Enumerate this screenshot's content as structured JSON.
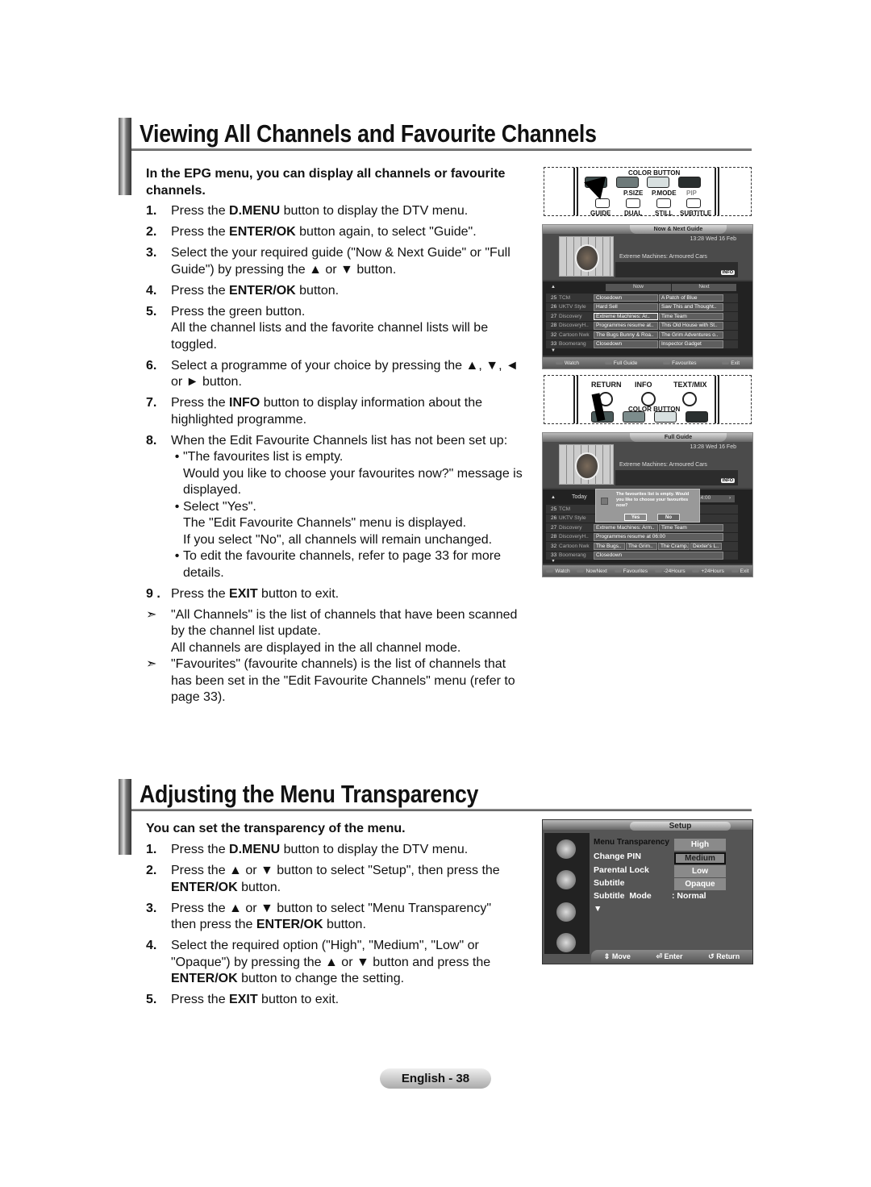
{
  "section1": {
    "title": "Viewing All Channels and Favourite Channels",
    "intro": "In the EPG menu, you can display all channels or favourite channels.",
    "steps": [
      {
        "num": "1.",
        "pre": "Press the ",
        "bold": "D.MENU",
        "post": " button to display the DTV menu."
      },
      {
        "num": "2.",
        "pre": "Press the ",
        "bold": "ENTER/OK",
        "post": " button again, to select \"Guide\"."
      },
      {
        "num": "3.",
        "pre": "Select the your required guide (\"Now & Next Guide\" or \"Full Guide\") by pressing the ▲ or ▼ button.",
        "bold": "",
        "post": ""
      },
      {
        "num": "4.",
        "pre": "Press the ",
        "bold": "ENTER/OK",
        "post": " button."
      },
      {
        "num": "5.",
        "pre": "Press the green button.",
        "bold": "",
        "post": "",
        "extra": "All the channel lists and the favorite channel lists will be toggled."
      },
      {
        "num": "6.",
        "pre": "Select a programme of your choice by pressing the ▲, ▼, ◄ or ► button.",
        "bold": "",
        "post": ""
      },
      {
        "num": "7.",
        "pre": "Press the ",
        "bold": "INFO",
        "post": " button to display information about the highlighted programme."
      },
      {
        "num": "8.",
        "pre": "When the Edit Favourite Channels list has not been set up:",
        "bold": "",
        "post": "",
        "bullets": [
          {
            "lines": [
              "\"The favourites list is empty.",
              "Would you like to choose your favourites now?\" message is displayed."
            ]
          },
          {
            "lines": [
              "Select \"Yes\".",
              "The \"Edit Favourite Channels\" menu is displayed.",
              "If you select \"No\", all channels will remain unchanged."
            ]
          },
          {
            "lines": [
              "To edit the favourite channels, refer to page 33 for more details."
            ]
          }
        ]
      },
      {
        "num": "9 .",
        "pre": "Press the ",
        "bold": "EXIT",
        "post": " button to exit."
      }
    ],
    "notes": [
      {
        "lines": [
          "\"All Channels\" is the list of channels that have been scanned by the channel list update.",
          "All channels are displayed in the all channel mode."
        ]
      },
      {
        "lines": [
          "\"Favourites\" (favourite channels) is the list of channels that has been set in the \"Edit Favourite Channels\" menu (refer to page 33)."
        ]
      }
    ],
    "note_symbol": "➣"
  },
  "remote1": {
    "color_button": "COLOR BUTTON",
    "labels": [
      "P.SIZE",
      "P.MODE",
      "PIP"
    ],
    "bottom_labels": [
      "GUIDE",
      "DUAL",
      "STILL",
      "SUBTITLE"
    ],
    "colors": [
      "#6e7a7a",
      "#d8e0e0",
      "#2a2f2f"
    ]
  },
  "remote2": {
    "labels": [
      "RETURN",
      "INFO",
      "TEXT/MIX"
    ],
    "color_button": "COLOR BUTTON",
    "colors": [
      "#4a5a5a",
      "#7c8c8c",
      "#d8e0e0",
      "#2a2f2f"
    ]
  },
  "now_next": {
    "header": "Now & Next Guide",
    "time": "13:28 Wed 16 Feb",
    "programme": "Extreme Machines: Armoured Cars",
    "info_badge": "INFO",
    "col_now": "Now",
    "col_next": "Next",
    "rows": [
      {
        "num": "25",
        "name": "TCM",
        "now": "Closedown",
        "next": "A Patch of Blue"
      },
      {
        "num": "26",
        "name": "UKTV Style",
        "now": "Hard Sell",
        "next": "Saw This and Thought.."
      },
      {
        "num": "27",
        "name": "Discovery",
        "now": "Extreme Machines: Ar..",
        "next": "Time Team"
      },
      {
        "num": "28",
        "name": "DiscoveryH..",
        "now": "Programmes resume at..",
        "next": "This Old House with St.."
      },
      {
        "num": "32",
        "name": "Cartoon Nwk",
        "now": "The Bugs Bunny & Roa..",
        "next": "The Grim Adventures o.."
      },
      {
        "num": "33",
        "name": "Boomerang",
        "now": "Closedown",
        "next": "Inspector Gadget"
      }
    ],
    "footer": [
      "Watch",
      "Full Guide",
      "Favourites",
      "Exit"
    ]
  },
  "full_guide": {
    "header": "Full Guide",
    "time": "13:28 Wed 16 Feb",
    "programme": "Extreme Machines: Armoured Cars",
    "info_badge": "INFO",
    "date": "Today",
    "time_col": "14:00",
    "rows": [
      {
        "num": "25",
        "name": "TCM",
        "cells": []
      },
      {
        "num": "26",
        "name": "UKTV Style",
        "cells": []
      },
      {
        "num": "27",
        "name": "Discovery",
        "cells": [
          "Extreme Machines: Arm..",
          "Time Team"
        ]
      },
      {
        "num": "28",
        "name": "DiscoveryH..",
        "cells": [
          "Programmes resume at 06:00"
        ]
      },
      {
        "num": "32",
        "name": "Cartoon Nwk",
        "cells": [
          "The Bugs..",
          "The Grim..",
          "The Cramp..",
          "Dexter's L.."
        ]
      },
      {
        "num": "33",
        "name": "Boomerang",
        "cells": [
          "Closedown"
        ]
      }
    ],
    "popup": {
      "message": "The favourites list is empty. Would you like to choose your favourites now?",
      "yes": "Yes",
      "no": "No"
    },
    "footer": [
      "Watch",
      "NowNext",
      "Favourites",
      "-24Hours",
      "+24Hours",
      "Exit"
    ]
  },
  "section2": {
    "title": "Adjusting the Menu Transparency",
    "intro": "You can set the transparency of the menu.",
    "steps": [
      {
        "num": "1.",
        "pre": "Press the ",
        "bold": "D.MENU",
        "post": " button to display the DTV menu."
      },
      {
        "num": "2.",
        "pre": "Press the ▲ or ▼ button to select \"Setup\", then press the ",
        "bold": "ENTER/OK",
        "post": " button."
      },
      {
        "num": "3.",
        "pre": "Press the ▲ or ▼ button to select \"Menu Transparency\" then press the ",
        "bold": "ENTER/OK",
        "post": " button."
      },
      {
        "num": "4.",
        "pre": "Select the required option (\"High\", \"Medium\", \"Low\" or \"Opaque\") by pressing the ▲ or ▼ button and press the ",
        "bold": "ENTER/OK",
        "post": " button to change the setting."
      },
      {
        "num": "5.",
        "pre": "Press the ",
        "bold": "EXIT",
        "post": " button to exit."
      }
    ]
  },
  "setup_menu": {
    "header": "Setup",
    "items": [
      "Menu Transparency",
      "Change PIN",
      "Parental Lock",
      "Subtitle",
      "Subtitle  Mode"
    ],
    "subtitle_mode_value": ": Normal",
    "more": "▼",
    "options": [
      "High",
      "Medium",
      "Low",
      "Opaque"
    ],
    "selected_option": "Medium",
    "footer": [
      "Move",
      "Enter",
      "Return"
    ]
  },
  "footer": {
    "page_label": "English - 38"
  }
}
